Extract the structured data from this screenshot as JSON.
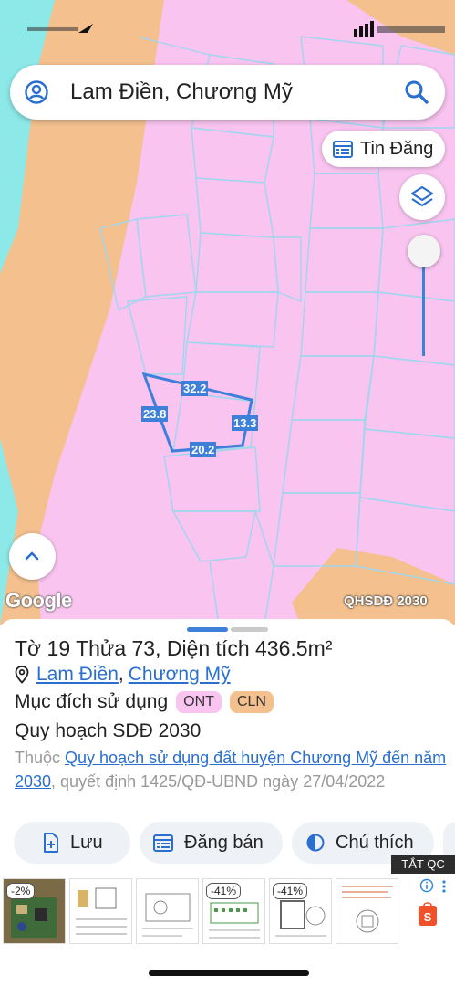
{
  "search": {
    "value": "Lam Điền, Chương Mỹ"
  },
  "buttons": {
    "tin_dang": "Tin Đăng"
  },
  "map": {
    "google_label": "Google",
    "layer_label": "QHSDĐ 2030",
    "dimensions": [
      "32.2",
      "23.8",
      "13.3",
      "20.2"
    ]
  },
  "parcel": {
    "title": "Tờ 19 Thửa 73, Diện tích 436.5m²",
    "location_1": "Lam Điền",
    "location_sep": ",",
    "location_2": "Chương Mỹ",
    "purpose_label": "Mục đích sử dụng",
    "badge_1": "ONT",
    "badge_2": "CLN",
    "plan_label": "Quy hoạch SDĐ 2030",
    "desc_prefix": "Thuộc ",
    "desc_link": "Quy hoạch sử dụng đất huyện Chương Mỹ đến năm 2030",
    "desc_suffix": ", quyết định 1425/QĐ-UBND ngày 27/04/2022"
  },
  "actions": {
    "save": "Lưu",
    "post": "Đăng bán",
    "legend": "Chú thích"
  },
  "ad": {
    "close_label": "TẮT QC",
    "badges": [
      "-2%",
      "-41%",
      "-41%"
    ]
  },
  "colors": {
    "accent": "#3d7fd9",
    "land_pink": "#f9c4f0",
    "land_orange": "#f3c08e",
    "water": "#8de8e8"
  }
}
